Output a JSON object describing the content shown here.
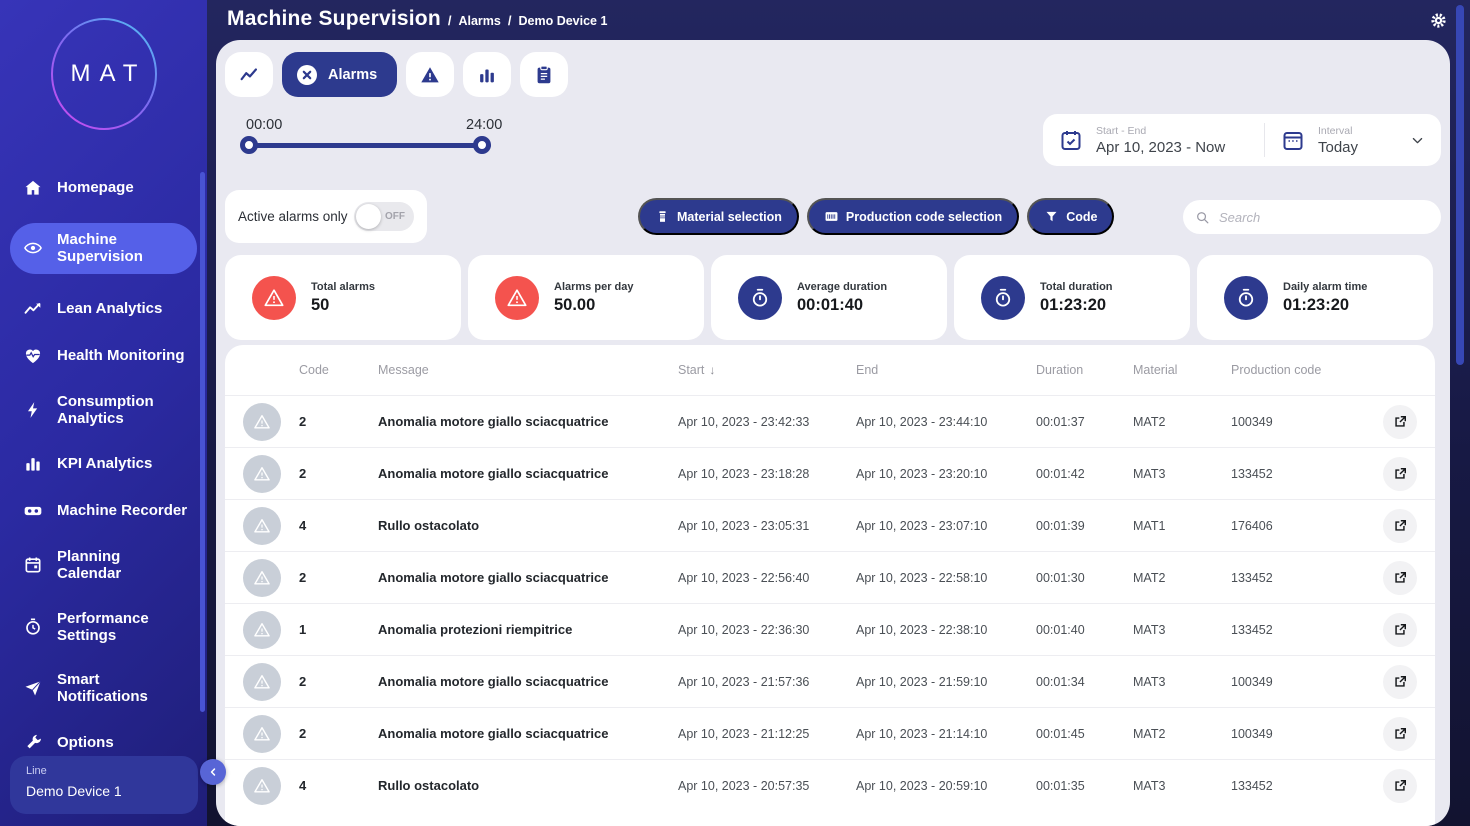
{
  "app": {
    "title": "Machine Supervision",
    "separator": "/",
    "breadcrumb": [
      "Alarms",
      "Demo Device 1"
    ]
  },
  "sidebar": {
    "logo_text": "MAT",
    "items": [
      {
        "label": "Homepage",
        "icon": "home",
        "active": false
      },
      {
        "label": "Machine\nSupervision",
        "icon": "eye",
        "active": true
      },
      {
        "label": "Lean Analytics",
        "icon": "trend",
        "active": false
      },
      {
        "label": "Health Monitoring",
        "icon": "heart-pulse",
        "active": false
      },
      {
        "label": "Consumption\nAnalytics",
        "icon": "bolt",
        "active": false
      },
      {
        "label": "KPI Analytics",
        "icon": "bar-chart",
        "active": false
      },
      {
        "label": "Machine Recorder",
        "icon": "recorder",
        "active": false
      },
      {
        "label": "Planning\nCalendar",
        "icon": "calendar",
        "active": false
      },
      {
        "label": "Performance\nSettings",
        "icon": "stopwatch",
        "active": false
      },
      {
        "label": "Smart\nNotifications",
        "icon": "send",
        "active": false
      },
      {
        "label": "Options",
        "icon": "wrench",
        "active": false
      }
    ],
    "device": {
      "type_label": "Line",
      "name": "Demo Device 1"
    }
  },
  "tabs": [
    {
      "name": "trend",
      "icon": "trend-line",
      "active": false
    },
    {
      "name": "alarms",
      "label": "Alarms",
      "icon": "x-circle",
      "active": true
    },
    {
      "name": "warnings",
      "icon": "warning-triangle",
      "active": false
    },
    {
      "name": "statistics",
      "icon": "bar-chart",
      "active": false
    },
    {
      "name": "report",
      "icon": "clipboard",
      "active": false
    }
  ],
  "time_slider": {
    "start_label": "00:00",
    "end_label": "24:00"
  },
  "date_range": {
    "label": "Start - End",
    "value": "Apr 10, 2023 - Now"
  },
  "interval": {
    "label": "Interval",
    "value": "Today"
  },
  "filters": {
    "active_alarms_label": "Active alarms only",
    "toggle_state": "OFF",
    "material_button": "Material selection",
    "production_code_button": "Production code selection",
    "code_button": "Code",
    "search_placeholder": "Search"
  },
  "stats": [
    {
      "label": "Total alarms",
      "value": "50",
      "icon": "alarm",
      "color": "#f4534e"
    },
    {
      "label": "Alarms per day",
      "value": "50.00",
      "icon": "alarm",
      "color": "#f4534e"
    },
    {
      "label": "Average duration",
      "value": "00:01:40",
      "icon": "timer",
      "color": "#2d3a8e"
    },
    {
      "label": "Total duration",
      "value": "01:23:20",
      "icon": "timer",
      "color": "#2d3a8e"
    },
    {
      "label": "Daily alarm time",
      "value": "01:23:20",
      "icon": "timer",
      "color": "#2d3a8e"
    }
  ],
  "table": {
    "columns": [
      "Code",
      "Message",
      "Start",
      "End",
      "Duration",
      "Material",
      "Production code"
    ],
    "sort_column": "Start",
    "sort_indicator": "↓",
    "rows": [
      {
        "code": "2",
        "message": "Anomalia motore giallo sciacquatrice",
        "start": "Apr 10, 2023 - 23:42:33",
        "end": "Apr 10, 2023 - 23:44:10",
        "duration": "00:01:37",
        "material": "MAT2",
        "production_code": "100349"
      },
      {
        "code": "2",
        "message": "Anomalia motore giallo sciacquatrice",
        "start": "Apr 10, 2023 - 23:18:28",
        "end": "Apr 10, 2023 - 23:20:10",
        "duration": "00:01:42",
        "material": "MAT3",
        "production_code": "133452"
      },
      {
        "code": "4",
        "message": "Rullo ostacolato",
        "start": "Apr 10, 2023 - 23:05:31",
        "end": "Apr 10, 2023 - 23:07:10",
        "duration": "00:01:39",
        "material": "MAT1",
        "production_code": "176406"
      },
      {
        "code": "2",
        "message": "Anomalia motore giallo sciacquatrice",
        "start": "Apr 10, 2023 - 22:56:40",
        "end": "Apr 10, 2023 - 22:58:10",
        "duration": "00:01:30",
        "material": "MAT2",
        "production_code": "133452"
      },
      {
        "code": "1",
        "message": "Anomalia protezioni riempitrice",
        "start": "Apr 10, 2023 - 22:36:30",
        "end": "Apr 10, 2023 - 22:38:10",
        "duration": "00:01:40",
        "material": "MAT3",
        "production_code": "133452"
      },
      {
        "code": "2",
        "message": "Anomalia motore giallo sciacquatrice",
        "start": "Apr 10, 2023 - 21:57:36",
        "end": "Apr 10, 2023 - 21:59:10",
        "duration": "00:01:34",
        "material": "MAT3",
        "production_code": "100349"
      },
      {
        "code": "2",
        "message": "Anomalia motore giallo sciacquatrice",
        "start": "Apr 10, 2023 - 21:12:25",
        "end": "Apr 10, 2023 - 21:14:10",
        "duration": "00:01:45",
        "material": "MAT2",
        "production_code": "100349"
      },
      {
        "code": "4",
        "message": "Rullo ostacolato",
        "start": "Apr 10, 2023 - 20:57:35",
        "end": "Apr 10, 2023 - 20:59:10",
        "duration": "00:01:35",
        "material": "MAT3",
        "production_code": "133452"
      }
    ]
  },
  "colors": {
    "accent": "#2d3a8e",
    "alert_red": "#f4534e",
    "sidebar_active": "#5560e8",
    "page_bg": "#171944"
  }
}
